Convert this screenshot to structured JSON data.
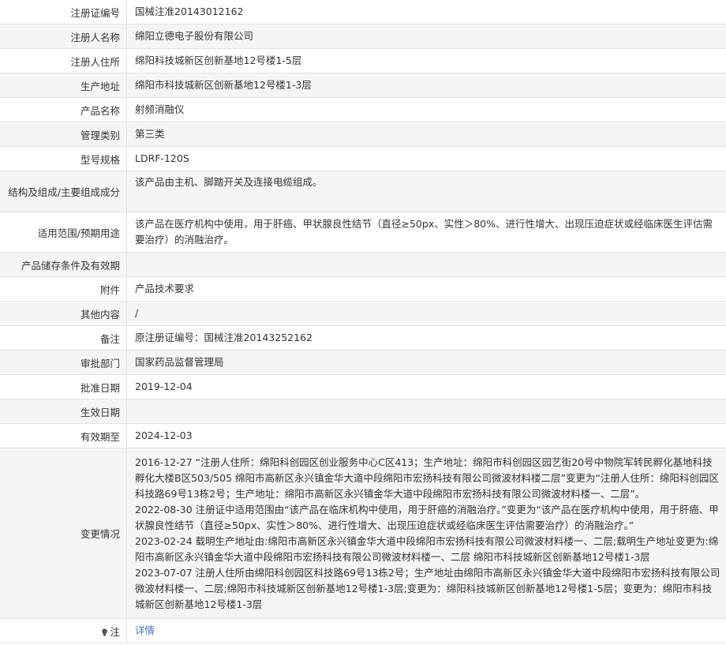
{
  "rows": {
    "reg_no": {
      "label": "注册证编号",
      "value": "国械注准20143012162"
    },
    "registrant": {
      "label": "注册人名称",
      "value": "绵阳立德电子股份有限公司"
    },
    "registrant_addr": {
      "label": "注册人住所",
      "value": "绵阳科技城新区创新基地12号楼1-5层"
    },
    "production_addr": {
      "label": "生产地址",
      "value": "绵阳市科技城新区创新基地12号楼1-3层"
    },
    "product_name": {
      "label": "产品名称",
      "value": "射频消融仪"
    },
    "category": {
      "label": "管理类别",
      "value": "第三类"
    },
    "model": {
      "label": "型号规格",
      "value": "LDRF-120S"
    },
    "structure": {
      "label": "结构及组成/主要组成成分",
      "value": "该产品由主机、脚踏开关及连接电缆组成。"
    },
    "scope": {
      "label": "适用范围/预期用途",
      "value": "该产品在医疗机构中使用，用于肝癌、甲状腺良性结节（直径≥50px、实性＞80%、进行性增大、出现压迫症状或经临床医生评估需要治疗）的消融治疗。"
    },
    "storage": {
      "label": "产品储存条件及有效期",
      "value": ""
    },
    "attachment": {
      "label": "附件",
      "value": "产品技术要求"
    },
    "other": {
      "label": "其他内容",
      "value": "/"
    },
    "remark": {
      "label": "备注",
      "value": "原注册证编号：国械注准20143252162"
    },
    "dept": {
      "label": "审批部门",
      "value": "国家药品监督管理局"
    },
    "approve_date": {
      "label": "批准日期",
      "value": "2019-12-04"
    },
    "effective_date": {
      "label": "生效日期",
      "value": ""
    },
    "expiry": {
      "label": "有效期至",
      "value": "2024-12-03"
    },
    "changes": {
      "label": "变更情况",
      "entries": [
        "2016-12-27 “注册人住所：绵阳科创园区创业服务中心C区413；生产地址：绵阳市科创园区园艺街20号中物院军转民孵化基地科技孵化大楼B区503/505 绵阳市高新区永兴镇金华大道中段绵阳市宏扬科技有限公司微波材料楼二层”变更为“注册人住所：绵阳科创园区科技路69号13栋2号；生产地址：绵阳市高新区永兴镇金华大道中段绵阳市宏扬科技有限公司微波材料楼一、二层”。",
        "2022-08-30 注册证中适用范围由“该产品在临床机构中使用，用于肝癌的消融治疗。”变更为“该产品在医疗机构中使用，用于肝癌、甲状腺良性结节（直径≥50px、实性＞80%、进行性增大、出现压迫症状或经临床医生评估需要治疗）的消融治疗。”",
        "2023-02-24 载明生产地址由:绵阳市高新区永兴镇金华大道中段绵阳市宏扬科技有限公司微波材料楼一、二层;载明生产地址变更为:绵阳市高新区永兴镇金华大道中段绵阳市宏扬科技有限公司微波材料楼一、二层 绵阳市科技城新区创新基地12号楼1-3层",
        "2023-07-07 注册人住所由绵阳科创园区科技路69号13栋2号；生产地址由绵阳市高新区永兴镇金华大道中段绵阳市宏扬科技有限公司微波材料楼一、二层;绵阳市科技城新区创新基地12号楼1-3层;变更为：绵阳科技城新区创新基地12号楼1-5层；变更为：绵阳市科技城新区创新基地12号楼1-3层"
      ]
    },
    "note": {
      "label": "注",
      "value": "详情"
    }
  },
  "icons": {
    "note_icon": "lightbulb-icon"
  },
  "colors": {
    "link": "#3a77c2",
    "border": "#e3e3e3",
    "stripe": "#f5f5f5"
  }
}
